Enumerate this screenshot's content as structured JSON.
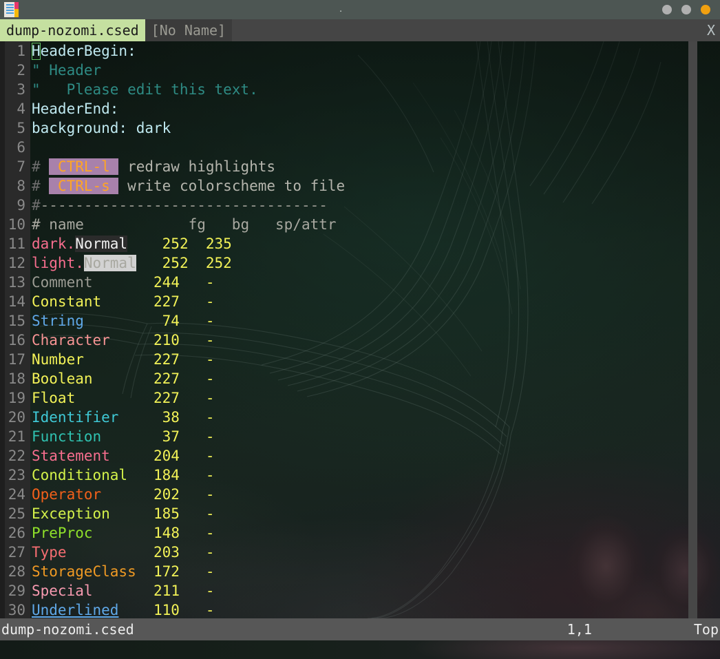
{
  "window": {
    "title": ".",
    "icon": "notepad-icon",
    "buttons": {
      "minimize_label": "",
      "maximize_label": "",
      "close_label": ""
    }
  },
  "tabline": {
    "tabs": [
      {
        "label": "dump-nozomi.csed",
        "active": true
      },
      {
        "label": "[No Name]",
        "active": false
      }
    ],
    "close_label": "X"
  },
  "editor": {
    "lines": [
      {
        "num": "1",
        "segments": [
          {
            "text": "HeaderBegin:",
            "cls": "c-hdr"
          }
        ]
      },
      {
        "num": "2",
        "segments": [
          {
            "text": "\" Header",
            "cls": "c-comment"
          }
        ]
      },
      {
        "num": "3",
        "segments": [
          {
            "text": "\"   Please edit this text.",
            "cls": "c-comment"
          }
        ]
      },
      {
        "num": "4",
        "segments": [
          {
            "text": "HeaderEnd:",
            "cls": "c-hdr"
          }
        ]
      },
      {
        "num": "5",
        "segments": [
          {
            "text": "background: dark",
            "cls": "c-hdr"
          }
        ]
      },
      {
        "num": "6",
        "segments": [
          {
            "text": "",
            "cls": "c-gray"
          }
        ]
      },
      {
        "num": "7",
        "segments": [
          {
            "text": "# ",
            "cls": "c-hash"
          },
          {
            "text": " CTRL-l ",
            "cls": "c-ctrl"
          },
          {
            "text": " redraw highlights",
            "cls": "c-gray"
          }
        ]
      },
      {
        "num": "8",
        "segments": [
          {
            "text": "# ",
            "cls": "c-hash"
          },
          {
            "text": " CTRL-s ",
            "cls": "c-ctrl"
          },
          {
            "text": " write colorscheme to file",
            "cls": "c-gray"
          }
        ]
      },
      {
        "num": "9",
        "segments": [
          {
            "text": "#",
            "cls": "c-hash"
          },
          {
            "text": "---------------------------------",
            "cls": "c-dash"
          }
        ]
      },
      {
        "num": "10",
        "segments": [
          {
            "text": "# name         ",
            "cls": "c-name"
          },
          {
            "text": "   fg   bg   sp/attr",
            "cls": "c-name"
          }
        ]
      },
      {
        "num": "11",
        "segments": [
          {
            "text": "dark.",
            "cls": "c-key"
          },
          {
            "text": "Normal",
            "cls": "sw-dark"
          },
          {
            "text": "    ",
            "cls": "c-gray"
          },
          {
            "text": "252",
            "cls": "c-num"
          },
          {
            "text": "  ",
            "cls": "c-gray"
          },
          {
            "text": "235",
            "cls": "c-num"
          }
        ]
      },
      {
        "num": "12",
        "segments": [
          {
            "text": "light.",
            "cls": "c-key"
          },
          {
            "text": "Normal",
            "cls": "sw-light"
          },
          {
            "text": "   ",
            "cls": "c-gray"
          },
          {
            "text": "252",
            "cls": "c-num"
          },
          {
            "text": "  ",
            "cls": "c-gray"
          },
          {
            "text": "252",
            "cls": "c-num"
          }
        ]
      },
      {
        "num": "13",
        "segments": [
          {
            "text": "Comment",
            "cls": "g-comment"
          },
          {
            "text": "       ",
            "cls": "c-gray"
          },
          {
            "text": "244",
            "cls": "c-num"
          },
          {
            "text": "   ",
            "cls": "c-gray"
          },
          {
            "text": "-",
            "cls": "c-dashcell"
          }
        ]
      },
      {
        "num": "14",
        "segments": [
          {
            "text": "Constant",
            "cls": "g-constant"
          },
          {
            "text": "      ",
            "cls": "c-gray"
          },
          {
            "text": "227",
            "cls": "c-num"
          },
          {
            "text": "   ",
            "cls": "c-gray"
          },
          {
            "text": "-",
            "cls": "c-dashcell"
          }
        ]
      },
      {
        "num": "15",
        "segments": [
          {
            "text": "String",
            "cls": "g-string"
          },
          {
            "text": "         ",
            "cls": "c-gray"
          },
          {
            "text": "74",
            "cls": "c-num"
          },
          {
            "text": "   ",
            "cls": "c-gray"
          },
          {
            "text": "-",
            "cls": "c-dashcell"
          }
        ]
      },
      {
        "num": "16",
        "segments": [
          {
            "text": "Character",
            "cls": "g-character"
          },
          {
            "text": "     ",
            "cls": "c-gray"
          },
          {
            "text": "210",
            "cls": "c-num"
          },
          {
            "text": "   ",
            "cls": "c-gray"
          },
          {
            "text": "-",
            "cls": "c-dashcell"
          }
        ]
      },
      {
        "num": "17",
        "segments": [
          {
            "text": "Number",
            "cls": "g-number"
          },
          {
            "text": "        ",
            "cls": "c-gray"
          },
          {
            "text": "227",
            "cls": "c-num"
          },
          {
            "text": "   ",
            "cls": "c-gray"
          },
          {
            "text": "-",
            "cls": "c-dashcell"
          }
        ]
      },
      {
        "num": "18",
        "segments": [
          {
            "text": "Boolean",
            "cls": "g-boolean"
          },
          {
            "text": "       ",
            "cls": "c-gray"
          },
          {
            "text": "227",
            "cls": "c-num"
          },
          {
            "text": "   ",
            "cls": "c-gray"
          },
          {
            "text": "-",
            "cls": "c-dashcell"
          }
        ]
      },
      {
        "num": "19",
        "segments": [
          {
            "text": "Float",
            "cls": "g-float"
          },
          {
            "text": "         ",
            "cls": "c-gray"
          },
          {
            "text": "227",
            "cls": "c-num"
          },
          {
            "text": "   ",
            "cls": "c-gray"
          },
          {
            "text": "-",
            "cls": "c-dashcell"
          }
        ]
      },
      {
        "num": "20",
        "segments": [
          {
            "text": "Identifier",
            "cls": "g-identifier"
          },
          {
            "text": "     ",
            "cls": "c-gray"
          },
          {
            "text": "38",
            "cls": "c-num"
          },
          {
            "text": "   ",
            "cls": "c-gray"
          },
          {
            "text": "-",
            "cls": "c-dashcell"
          }
        ]
      },
      {
        "num": "21",
        "segments": [
          {
            "text": "Function",
            "cls": "g-function"
          },
          {
            "text": "       ",
            "cls": "c-gray"
          },
          {
            "text": "37",
            "cls": "c-num"
          },
          {
            "text": "   ",
            "cls": "c-gray"
          },
          {
            "text": "-",
            "cls": "c-dashcell"
          }
        ]
      },
      {
        "num": "22",
        "segments": [
          {
            "text": "Statement",
            "cls": "g-statement"
          },
          {
            "text": "     ",
            "cls": "c-gray"
          },
          {
            "text": "204",
            "cls": "c-num"
          },
          {
            "text": "   ",
            "cls": "c-gray"
          },
          {
            "text": "-",
            "cls": "c-dashcell"
          }
        ]
      },
      {
        "num": "23",
        "segments": [
          {
            "text": "Conditional",
            "cls": "g-conditional"
          },
          {
            "text": "   ",
            "cls": "c-gray"
          },
          {
            "text": "184",
            "cls": "c-num"
          },
          {
            "text": "   ",
            "cls": "c-gray"
          },
          {
            "text": "-",
            "cls": "c-dashcell"
          }
        ]
      },
      {
        "num": "24",
        "segments": [
          {
            "text": "Operator",
            "cls": "g-operator"
          },
          {
            "text": "      ",
            "cls": "c-gray"
          },
          {
            "text": "202",
            "cls": "c-num"
          },
          {
            "text": "   ",
            "cls": "c-gray"
          },
          {
            "text": "-",
            "cls": "c-dashcell"
          }
        ]
      },
      {
        "num": "25",
        "segments": [
          {
            "text": "Exception",
            "cls": "g-exception"
          },
          {
            "text": "     ",
            "cls": "c-gray"
          },
          {
            "text": "185",
            "cls": "c-num"
          },
          {
            "text": "   ",
            "cls": "c-gray"
          },
          {
            "text": "-",
            "cls": "c-dashcell"
          }
        ]
      },
      {
        "num": "26",
        "segments": [
          {
            "text": "PreProc",
            "cls": "g-preproc"
          },
          {
            "text": "       ",
            "cls": "c-gray"
          },
          {
            "text": "148",
            "cls": "c-num"
          },
          {
            "text": "   ",
            "cls": "c-gray"
          },
          {
            "text": "-",
            "cls": "c-dashcell"
          }
        ]
      },
      {
        "num": "27",
        "segments": [
          {
            "text": "Type",
            "cls": "g-type"
          },
          {
            "text": "          ",
            "cls": "c-gray"
          },
          {
            "text": "203",
            "cls": "c-num"
          },
          {
            "text": "   ",
            "cls": "c-gray"
          },
          {
            "text": "-",
            "cls": "c-dashcell"
          }
        ]
      },
      {
        "num": "28",
        "segments": [
          {
            "text": "StorageClass",
            "cls": "g-storage"
          },
          {
            "text": "  ",
            "cls": "c-gray"
          },
          {
            "text": "172",
            "cls": "c-num"
          },
          {
            "text": "   ",
            "cls": "c-gray"
          },
          {
            "text": "-",
            "cls": "c-dashcell"
          }
        ]
      },
      {
        "num": "29",
        "segments": [
          {
            "text": "Special",
            "cls": "g-special"
          },
          {
            "text": "       ",
            "cls": "c-gray"
          },
          {
            "text": "211",
            "cls": "c-num"
          },
          {
            "text": "   ",
            "cls": "c-gray"
          },
          {
            "text": "-",
            "cls": "c-dashcell"
          }
        ]
      },
      {
        "num": "30",
        "segments": [
          {
            "text": "Underlined",
            "cls": "g-underlined"
          },
          {
            "text": "    ",
            "cls": "c-gray"
          },
          {
            "text": "110",
            "cls": "c-num"
          },
          {
            "text": "   ",
            "cls": "c-gray"
          },
          {
            "text": "-",
            "cls": "c-dashcell"
          }
        ]
      }
    ]
  },
  "statusbar": {
    "filename": "dump-nozomi.csed",
    "position": "1,1",
    "scroll": "Top"
  },
  "colors": {
    "titlebar_bg": "#4d5653",
    "tab_active_bg": "#c5e0a0",
    "tab_inactive_bg": "#3b3b3b",
    "tabline_bg": "#454545",
    "statusbar_bg": "#575757",
    "gutter_bg": "#2a2a2a",
    "close_button": "#f0a010",
    "cursor_outline": "#63c163",
    "ctrl_highlight_bg": "#a881ab",
    "ctrl_highlight_fg": "#ffa524"
  }
}
